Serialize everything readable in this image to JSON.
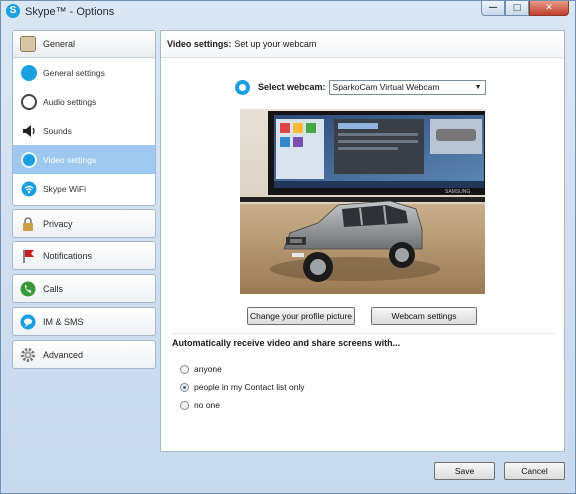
{
  "window": {
    "title": "Skype™ - Options",
    "controls": {
      "minimize": "—",
      "maximize": "□",
      "close": "✕"
    }
  },
  "sidebar": {
    "general": {
      "label": "General",
      "items": [
        {
          "label": "General settings",
          "icon": "skype-icon",
          "active": false
        },
        {
          "label": "Audio settings",
          "icon": "headset-icon",
          "active": false
        },
        {
          "label": "Sounds",
          "icon": "speaker-icon",
          "active": false
        },
        {
          "label": "Video settings",
          "icon": "webcam-icon",
          "active": true
        },
        {
          "label": "Skype WiFi",
          "icon": "wifi-icon",
          "active": false
        }
      ]
    },
    "groups": [
      {
        "label": "Privacy",
        "icon": "lock-icon"
      },
      {
        "label": "Notifications",
        "icon": "flag-icon"
      },
      {
        "label": "Calls",
        "icon": "phone-icon"
      },
      {
        "label": "IM & SMS",
        "icon": "chat-icon"
      },
      {
        "label": "Advanced",
        "icon": "gear-icon"
      }
    ]
  },
  "content": {
    "header_bold": "Video settings:",
    "header_text": "Set up your webcam",
    "select_label": "Select webcam:",
    "webcam_selected": "SparkoCam Virtual Webcam",
    "profile_button": "Change your profile picture",
    "webcam_settings_button": "Webcam settings",
    "auto_receive_title": "Automatically receive video and share screens with...",
    "options": [
      {
        "label": "anyone",
        "checked": false
      },
      {
        "label": "people in my Contact list only",
        "checked": true
      },
      {
        "label": "no one",
        "checked": false
      }
    ],
    "preview_brand_text": "SAMSUNG"
  },
  "footer": {
    "save": "Save",
    "cancel": "Cancel"
  },
  "colors": {
    "accent": "#1aa0e0",
    "active_nav": "#9ec8ef",
    "window_bg": "#c7d9ee"
  }
}
